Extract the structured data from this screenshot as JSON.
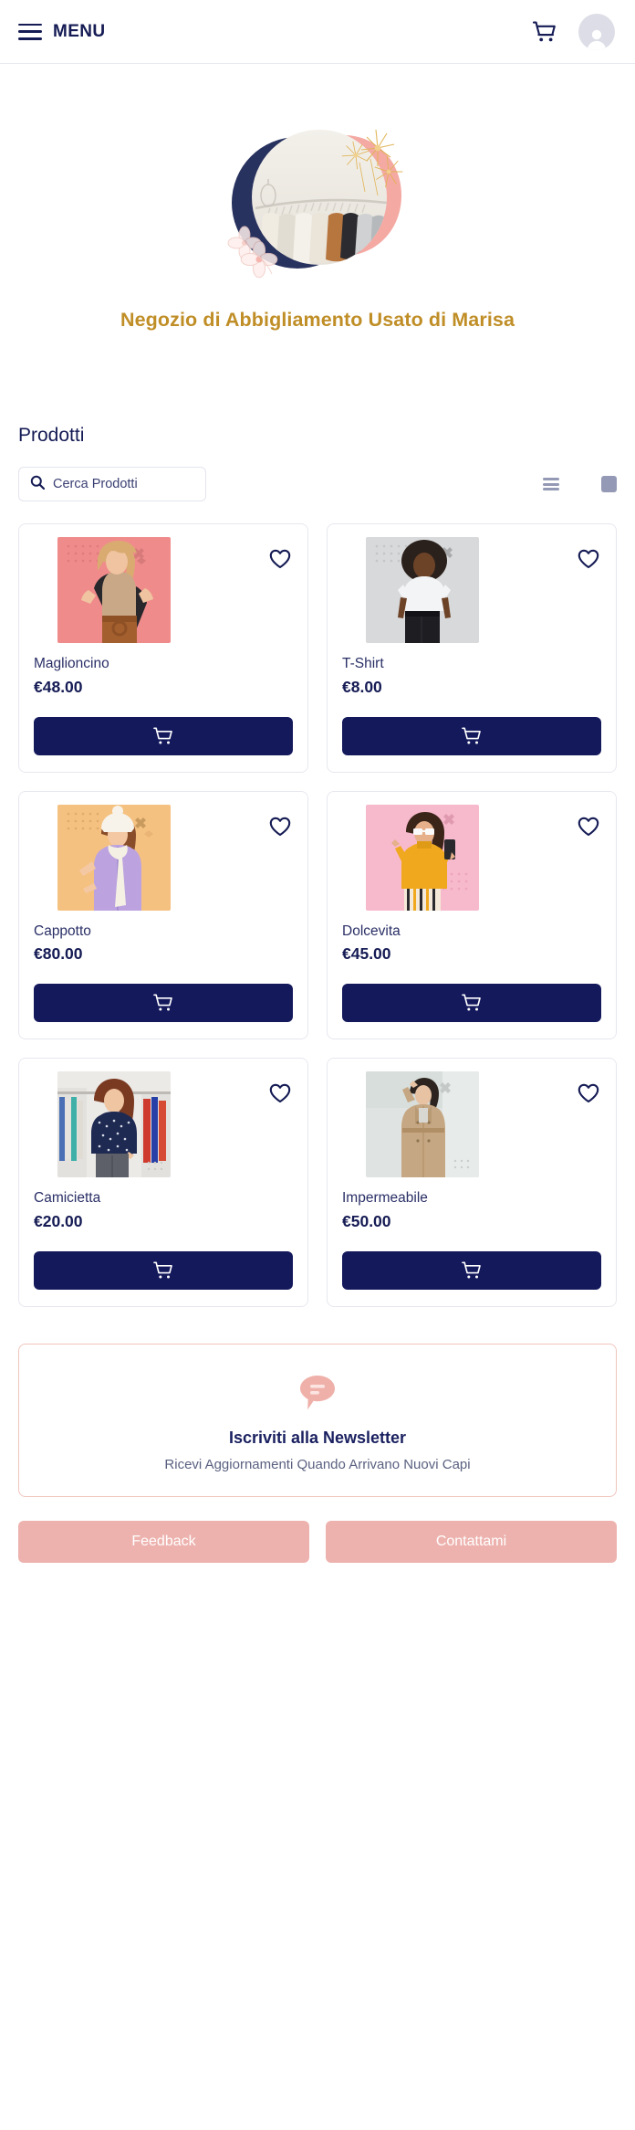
{
  "header": {
    "menu_label": "MENU",
    "menu_icon": "hamburger-icon",
    "cart_icon": "shopping-cart-icon",
    "avatar_icon": "user-avatar-icon"
  },
  "hero": {
    "logo_icon": "clothing-rack-logo",
    "store_title": "Negozio di Abbigliamento Usato di Marisa",
    "title_color": "#c08e27",
    "accent_navy": "#28325e",
    "accent_pink": "#f4a9a3",
    "accent_gold": "#e3b champ"
  },
  "products_section": {
    "title": "Prodotti",
    "search": {
      "placeholder": "Cerca Prodotti",
      "value": "",
      "icon": "search-icon"
    },
    "view_toggles": [
      {
        "name": "list-view",
        "icon": "list-view-icon",
        "active": false
      },
      {
        "name": "grid-view",
        "icon": "grid-view-icon",
        "active": true
      },
      {
        "name": "large-view",
        "icon": "large-card-view-icon",
        "active": false
      }
    ],
    "cart_button_icon": "shopping-cart-icon",
    "favorite_icon": "heart-outline-icon",
    "items": [
      {
        "name": "Maglioncino",
        "price": "€48.00",
        "bg": "#f08b8b",
        "image": "woman-in-beige-sweater-photo"
      },
      {
        "name": "T-Shirt",
        "price": "€8.00",
        "bg": "#d8d9da",
        "image": "woman-in-white-tshirt-photo"
      },
      {
        "name": "Cappotto",
        "price": "€80.00",
        "bg": "#f5c181",
        "image": "woman-in-lilac-coat-photo"
      },
      {
        "name": "Dolcevita",
        "price": "€45.00",
        "bg": "#f7b9cc",
        "image": "woman-in-yellow-turtleneck-photo"
      },
      {
        "name": "Camicietta",
        "price": "€20.00",
        "bg": "#e9e6e2",
        "image": "woman-in-polka-blouse-photo"
      },
      {
        "name": "Impermeabile",
        "price": "€50.00",
        "bg": "#dfe4e2",
        "image": "woman-in-beige-trenchcoat-photo"
      }
    ]
  },
  "newsletter": {
    "icon": "chat-bubble-icon",
    "title": "Iscriviti alla Newsletter",
    "subtitle": "Ricevi Aggiornamenti Quando Arrivano Nuovi Capi",
    "border_color": "#f0c5bd"
  },
  "footer": {
    "buttons": [
      {
        "label": "Feedback",
        "name": "feedback-button"
      },
      {
        "label": "Contattami",
        "name": "contact-button"
      }
    ],
    "button_color": "#edb2ae"
  }
}
